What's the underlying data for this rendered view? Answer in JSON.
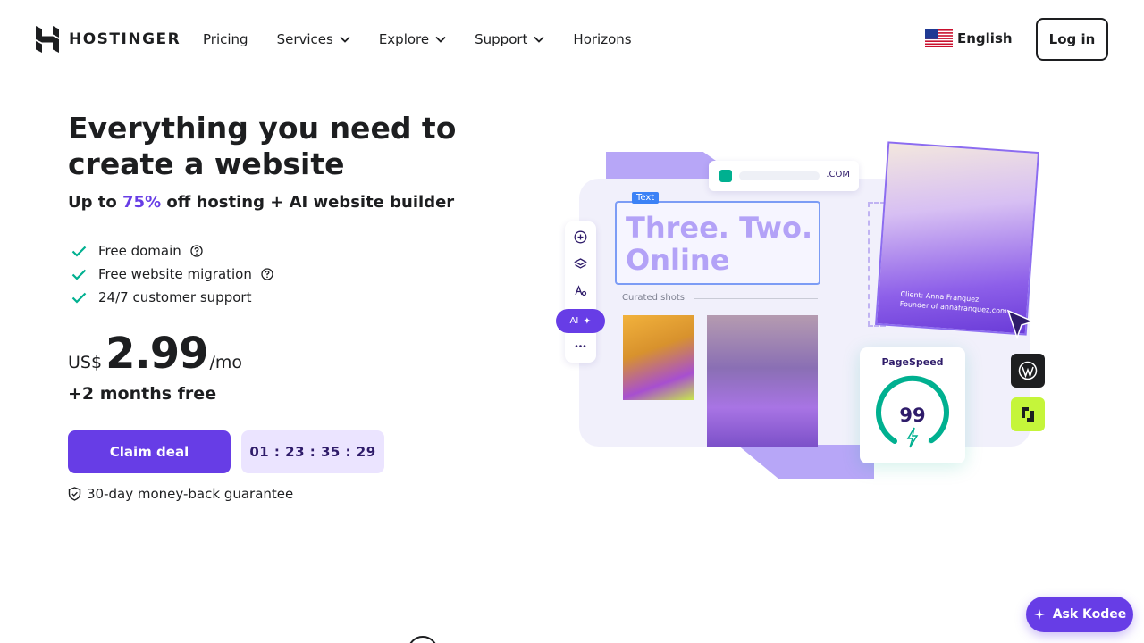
{
  "header": {
    "brand": "HOSTINGER",
    "nav": [
      {
        "label": "Pricing",
        "has_dropdown": false
      },
      {
        "label": "Services",
        "has_dropdown": true
      },
      {
        "label": "Explore",
        "has_dropdown": true
      },
      {
        "label": "Support",
        "has_dropdown": true
      },
      {
        "label": "Horizons",
        "has_dropdown": false
      }
    ],
    "language": {
      "label": "English",
      "flag_icon": "us-flag-icon"
    },
    "login_label": "Log in"
  },
  "hero": {
    "title": "Everything you need to create a website",
    "subtitle_prefix": "Up to ",
    "subtitle_accent": "75%",
    "subtitle_suffix": " off hosting + AI website builder",
    "features": [
      {
        "label": "Free domain",
        "info": true
      },
      {
        "label": "Free website migration",
        "info": true
      },
      {
        "label": "24/7 customer support",
        "info": false
      }
    ],
    "price": {
      "currency": "US$",
      "amount": "2.99",
      "period": "/mo"
    },
    "bonus": "+2 months free",
    "cta_label": "Claim deal",
    "timer": "01 : 23 : 35 : 29",
    "guarantee": "30-day money-back guarantee"
  },
  "illustration": {
    "url_domain": ".COM",
    "text_tag": "Text",
    "headline_line1": "Three. Two.",
    "headline_line2": "Online",
    "curated_label": "Curated shots",
    "ai_label": "AI",
    "photo_caption_line1": "Client: Anna Franquez",
    "photo_caption_line2": "Founder of annafranquez.com",
    "pagespeed_title": "PageSpeed",
    "pagespeed_score": "99",
    "pagespeed_value": 99
  },
  "assistant": {
    "label": "Ask Kodee"
  },
  "colors": {
    "brand": "#673de6",
    "text": "#1d1e20",
    "timer_bg": "#ebe4ff",
    "check": "#00b090",
    "lavender": "#b7a6f7"
  }
}
